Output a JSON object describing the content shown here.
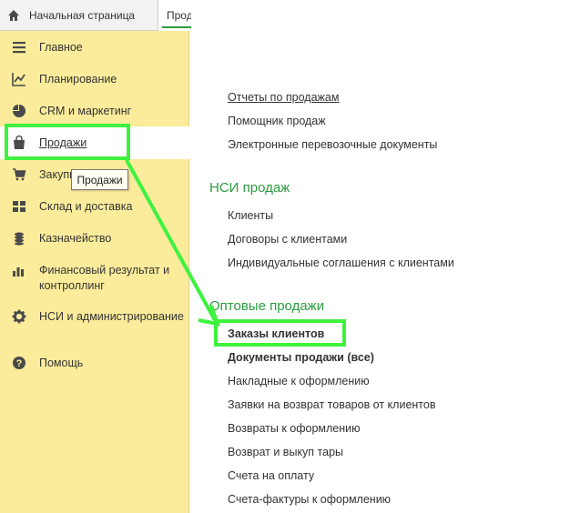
{
  "tabs": {
    "home_label": "Начальная страница",
    "active_label": "Продажи"
  },
  "sidebar": {
    "items": [
      {
        "label": "Главное",
        "icon": "menu-lines-icon"
      },
      {
        "label": "Планирование",
        "icon": "chart-line-icon"
      },
      {
        "label": "CRM и маркетинг",
        "icon": "pie-chart-icon"
      },
      {
        "label": "Продажи",
        "icon": "shopping-bag-icon"
      },
      {
        "label": "Закупки",
        "icon": "cart-icon"
      },
      {
        "label": "Склад и доставка",
        "icon": "grid-icon"
      },
      {
        "label": "Казначейство",
        "icon": "coins-icon"
      },
      {
        "label": "Финансовый результат и контроллинг",
        "icon": "bar-chart-icon"
      },
      {
        "label": "НСИ и администрирование",
        "icon": "gear-icon"
      },
      {
        "label": "Помощь",
        "icon": "question-icon"
      }
    ],
    "tooltip": "Продажи"
  },
  "content": {
    "reports": [
      "Отчеты по продажам",
      "Помощник продаж",
      "Электронные перевозочные документы"
    ],
    "nsi_title": "НСИ продаж",
    "nsi_links": [
      "Клиенты",
      "Договоры с клиентами",
      "Индивидуальные соглашения с клиентами"
    ],
    "wholesale_title": "Оптовые продажи",
    "wholesale_links": [
      "Заказы клиентов",
      "Документы продажи (все)",
      "Накладные к оформлению",
      "Заявки на возврат товаров от клиентов",
      "Возвраты к оформлению",
      "Возврат и выкуп тары",
      "Счета на оплату",
      "Счета-фактуры к оформлению"
    ]
  },
  "colors": {
    "sidebar_bg": "#fbec9b",
    "section_title": "#2a9d3f",
    "highlight": "#3ef23e"
  }
}
